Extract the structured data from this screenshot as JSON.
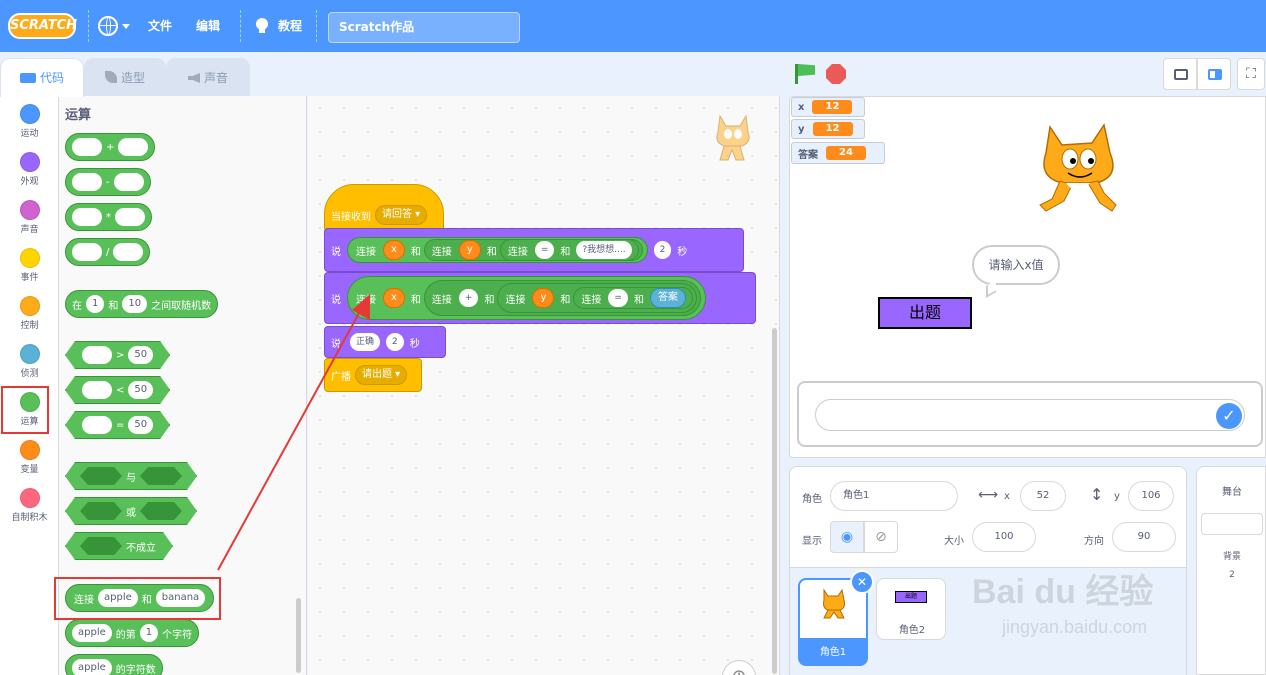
{
  "menubar": {
    "logo": "SCRATCH",
    "language_icon": "globe-icon",
    "file": "文件",
    "edit": "编辑",
    "tutorials": "教程",
    "project_title": "Scratch作品"
  },
  "tabs": {
    "code": "代码",
    "costumes": "造型",
    "sounds": "声音"
  },
  "categories": [
    {
      "label": "运动",
      "color": "#4c97ff"
    },
    {
      "label": "外观",
      "color": "#9966ff"
    },
    {
      "label": "声音",
      "color": "#cf63cf"
    },
    {
      "label": "事件",
      "color": "#ffd500"
    },
    {
      "label": "控制",
      "color": "#ffab19"
    },
    {
      "label": "侦测",
      "color": "#5cb1d6"
    },
    {
      "label": "运算",
      "color": "#59c059"
    },
    {
      "label": "变量",
      "color": "#ff8c1a"
    },
    {
      "label": "自制积木",
      "color": "#ff6680"
    }
  ],
  "palette": {
    "title": "运算",
    "add": "+",
    "sub": "-",
    "mul": "*",
    "div": "/",
    "random": {
      "t1": "在",
      "a": "1",
      "t2": "和",
      "b": "10",
      "t3": "之间取随机数"
    },
    "gt": {
      "op": ">",
      "v": "50"
    },
    "lt": {
      "op": "<",
      "v": "50"
    },
    "eq": {
      "op": "=",
      "v": "50"
    },
    "and": "与",
    "or": "或",
    "not": "不成立",
    "join": {
      "t1": "连接",
      "a": "apple",
      "t2": "和",
      "b": "banana"
    },
    "letter": {
      "a": "apple",
      "t1": "的第",
      "n": "1",
      "t2": "个字符"
    },
    "length": {
      "a": "apple",
      "t1": "的字符数"
    }
  },
  "script": {
    "hat": {
      "label": "当接收到",
      "value": "请回答"
    },
    "say1": {
      "say": "说",
      "join": "连接",
      "x": "x",
      "and": "和",
      "y": "y",
      "eq": "=",
      "text": "?我想想....",
      "secs_val": "2",
      "secs": "秒"
    },
    "say2": {
      "say": "说",
      "join": "连接",
      "x": "x",
      "and": "和",
      "plus": "+",
      "y": "y",
      "eq": "=",
      "answer": "答案"
    },
    "say3": {
      "say": "说",
      "value": "正确",
      "secs_val": "2",
      "secs": "秒"
    },
    "broadcast": {
      "label": "广播",
      "value": "请出题"
    }
  },
  "stage": {
    "monitors": [
      {
        "name": "x",
        "value": "12"
      },
      {
        "name": "y",
        "value": "12"
      },
      {
        "name": "答案",
        "value": "24"
      }
    ],
    "speech": "请输入x值",
    "button_sprite": "出题",
    "answer_input": ""
  },
  "sprite_info": {
    "sprite_label": "角色",
    "sprite_name": "角色1",
    "x_label": "x",
    "x": "52",
    "y_label": "y",
    "y": "106",
    "show_label": "显示",
    "size_label": "大小",
    "size": "100",
    "direction_label": "方向",
    "direction": "90"
  },
  "sprites": [
    {
      "name": "角色1",
      "selected": true
    },
    {
      "name": "角色2",
      "selected": false,
      "thumb_text": "出题"
    }
  ],
  "stage_pane": {
    "title": "舞台",
    "backdrops_label": "背景",
    "backdrops_count": "2"
  },
  "watermark": {
    "brand": "Bai du 经验",
    "url": "jingyan.baidu.com"
  },
  "colors": {
    "menubar": "#4c97ff",
    "operators": "#59c059",
    "looks": "#9966ff",
    "events": "#ffbf00",
    "variables": "#ff8c1a",
    "annotation": "#e53935"
  }
}
